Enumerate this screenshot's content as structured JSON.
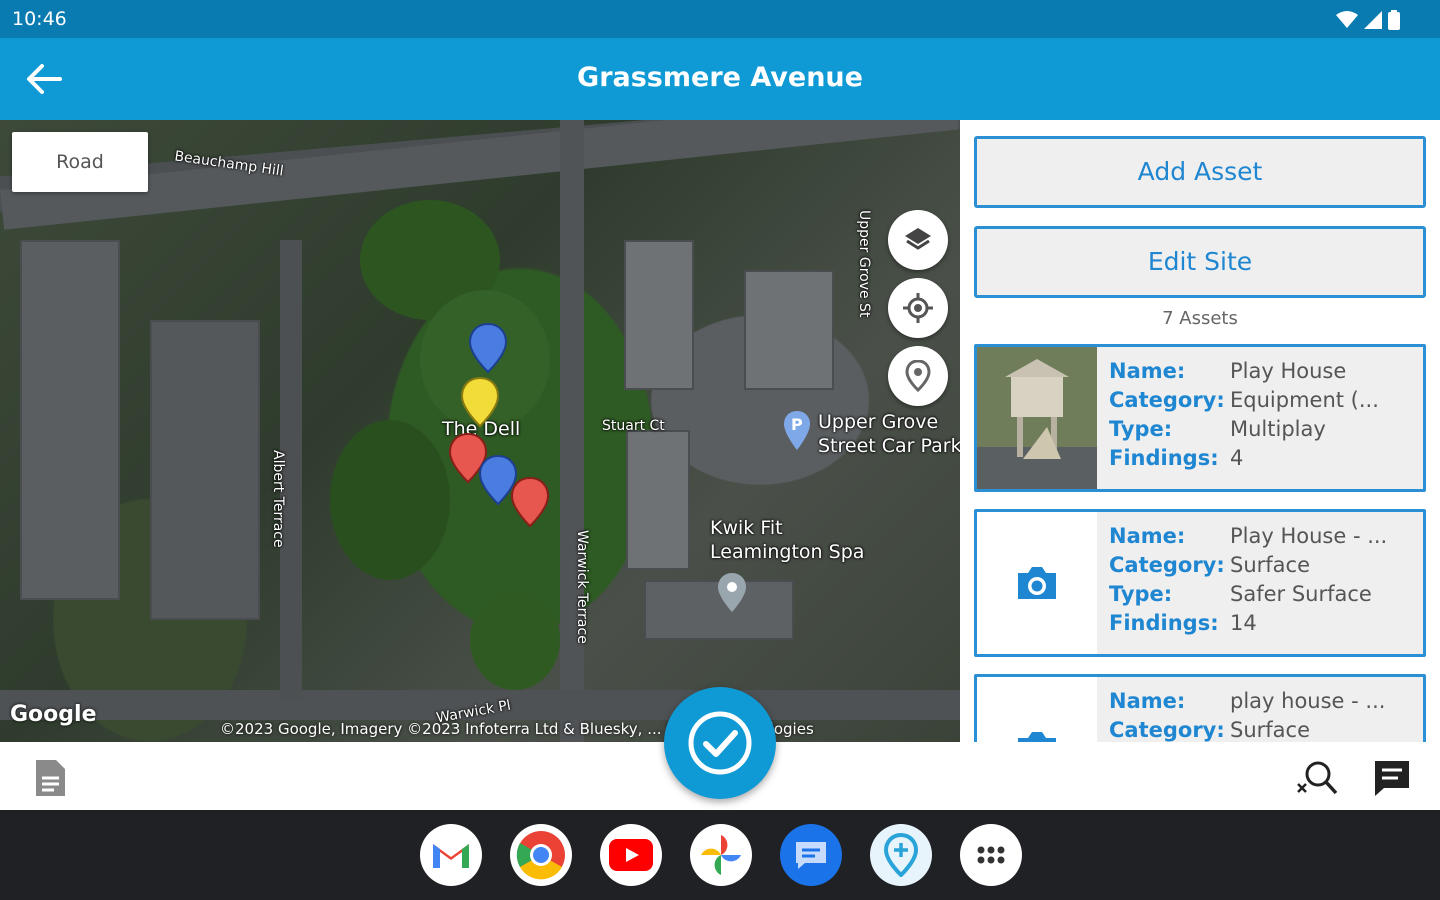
{
  "status_bar": {
    "time": "10:46",
    "icons": [
      "wifi-icon",
      "signal-icon",
      "battery-icon"
    ]
  },
  "app_bar": {
    "title": "Grassmere Avenue",
    "back_icon": "arrow-back-icon"
  },
  "map": {
    "map_type_button": "Road",
    "controls": [
      "layers-icon",
      "my-location-icon",
      "add-marker-icon"
    ],
    "labels": {
      "the_dell": "The Dell",
      "car_park": "Upper Grove\nStreet Car Park",
      "kwik_fit": "Kwik Fit\nLeamington Spa",
      "beauchamp_hill": "Beauchamp Hill",
      "upper_grove_st": "Upper Grove St",
      "stuart_ct": "Stuart Ct",
      "warwick_terrace": "Warwick Terrace",
      "warwick_pl": "Warwick Pl",
      "albert_terrace": "Albert Terrace"
    },
    "logo": "Google",
    "attribution": "©2023 Google, Imagery ©2023 Infoterra Ltd & Bluesky, ... Maxar Technologies",
    "markers": [
      {
        "color": "#4a7ddf"
      },
      {
        "color": "#f1dc3a"
      },
      {
        "color": "#e8574f"
      },
      {
        "color": "#4a7ddf"
      },
      {
        "color": "#e8574f"
      }
    ]
  },
  "panel": {
    "add_asset": "Add Asset",
    "edit_site": "Edit Site",
    "asset_count": "7 Assets",
    "field_labels": {
      "name": "Name:",
      "category": "Category:",
      "type": "Type:",
      "findings": "Findings:"
    },
    "assets": [
      {
        "name": "Play House",
        "category": "Equipment (...",
        "type": "Multiplay",
        "findings": "4",
        "thumbnail": "photo"
      },
      {
        "name": "Play House - ...",
        "category": "Surface",
        "type": "Safer Surface",
        "findings": "14",
        "thumbnail": "camera-icon"
      },
      {
        "name": "play house - ...",
        "category": "Surface",
        "type": "",
        "findings": "",
        "thumbnail": "camera-icon"
      }
    ]
  },
  "bottom_bar": {
    "left_icon": "document-icon",
    "fab_icon": "check-circle-icon",
    "right_icons": [
      "search-clear-icon",
      "comment-icon"
    ]
  },
  "dock": {
    "apps": [
      "gmail-icon",
      "chrome-icon",
      "youtube-icon",
      "photos-icon",
      "messages-icon",
      "maps-marker-app-icon",
      "app-drawer-icon"
    ]
  },
  "colors": {
    "primary": "#0f9ad6",
    "status_bar": "#0a7bb0",
    "accent_text": "#1f86d1",
    "card_border": "#2b8fd3"
  }
}
